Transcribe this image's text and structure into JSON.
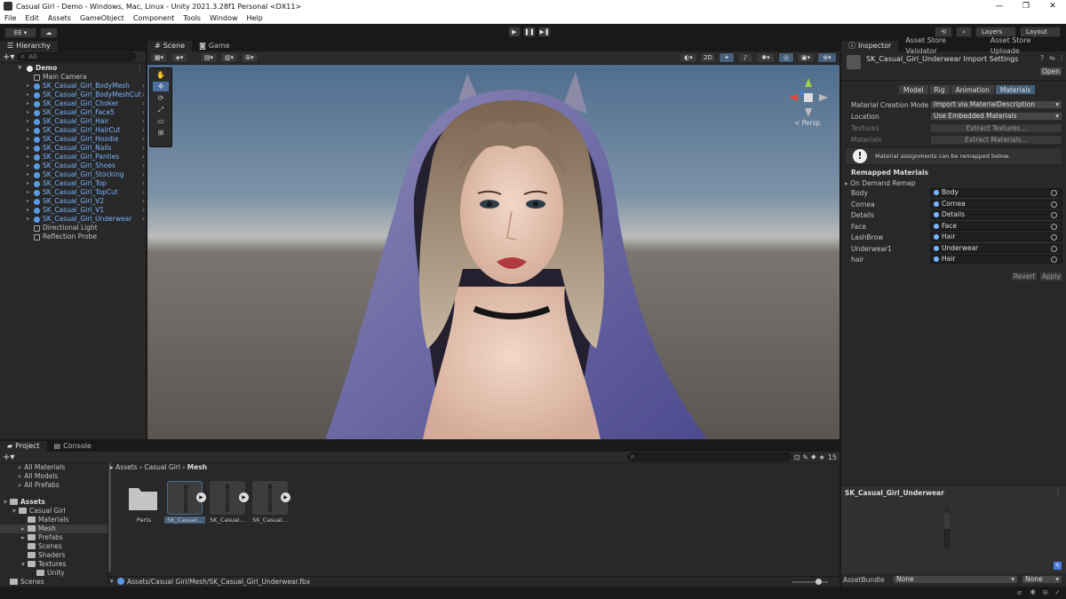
{
  "window": {
    "title": "Casual Girl - Demo - Windows, Mac, Linux - Unity 2021.3.28f1 Personal <DX11>",
    "minimize": "—",
    "maximize": "❐",
    "close": "✕"
  },
  "menu": [
    "File",
    "Edit",
    "Assets",
    "GameObject",
    "Component",
    "Tools",
    "Window",
    "Help"
  ],
  "toolbar": {
    "account": "EE ▾",
    "cloud": "☁",
    "play": "▶",
    "pause": "❚❚",
    "step": "▶❚",
    "history": "⟲",
    "search": "⌕",
    "layers": "Layers",
    "layout": "Layout"
  },
  "hierarchy": {
    "tab": "Hierarchy",
    "search_placeholder": "All",
    "root": "Demo",
    "items": [
      {
        "name": "Main Camera",
        "prefab": false
      },
      {
        "name": "SK_Casual_Girl_BodyMesh",
        "prefab": true
      },
      {
        "name": "SK_Casual_Girl_BodyMeshCut",
        "prefab": true
      },
      {
        "name": "SK_Casual_Girl_Choker",
        "prefab": true
      },
      {
        "name": "SK_Casual_Girl_Face5",
        "prefab": true
      },
      {
        "name": "SK_Casual_Girl_Hair",
        "prefab": true
      },
      {
        "name": "SK_Casual_Girl_HairCut",
        "prefab": true
      },
      {
        "name": "SK_Casual_Girl_Hoodie",
        "prefab": true
      },
      {
        "name": "SK_Casual_Girl_Nails",
        "prefab": true
      },
      {
        "name": "SK_Casual_Girl_Panties",
        "prefab": true
      },
      {
        "name": "SK_Casual_Girl_Shoes",
        "prefab": true
      },
      {
        "name": "SK_Casual_Girl_Stocking",
        "prefab": true
      },
      {
        "name": "SK_Casual_Girl_Top",
        "prefab": true
      },
      {
        "name": "SK_Casual_Girl_TopCut",
        "prefab": true
      },
      {
        "name": "SK_Casual_Girl_V2",
        "prefab": true
      },
      {
        "name": "SK_Casual_Girl_V1",
        "prefab": true
      },
      {
        "name": "SK_Casual_Girl_Underwear",
        "prefab": true
      },
      {
        "name": "Directional Light",
        "prefab": false
      },
      {
        "name": "Reflection Probe",
        "prefab": false
      }
    ]
  },
  "scene": {
    "tab_scene": "Scene",
    "tab_game": "Game",
    "mode_2d": "2D",
    "persp_label": "≺ Persp"
  },
  "inspector": {
    "tabs": [
      "Inspector",
      "Asset Store Validator",
      "Asset Store Uploade"
    ],
    "title": "SK_Casual_Girl_Underwear Import Settings",
    "open_button": "Open",
    "subtabs": [
      "Model",
      "Rig",
      "Animation",
      "Materials"
    ],
    "material_creation_mode_label": "Material Creation Mode",
    "material_creation_mode_value": "Import via MaterialDescription",
    "location_label": "Location",
    "location_value": "Use Embedded Materials",
    "textures_label": "Textures",
    "extract_textures": "Extract Textures...",
    "materials_label": "Materials",
    "extract_materials": "Extract Materials...",
    "info": "Material assignments can be remapped below.",
    "remapped_header": "Remapped Materials",
    "on_demand": "On Demand Remap",
    "remaps": [
      {
        "slot": "Body",
        "material": "Body"
      },
      {
        "slot": "Cornea",
        "material": "Cornea"
      },
      {
        "slot": "Details",
        "material": "Details"
      },
      {
        "slot": "Face",
        "material": "Face"
      },
      {
        "slot": "LashBrow",
        "material": "Hair"
      },
      {
        "slot": "Underwear1",
        "material": "Underwear"
      },
      {
        "slot": "hair",
        "material": "Hair"
      }
    ],
    "revert": "Revert",
    "apply": "Apply",
    "preview_title": "SK_Casual_Girl_Underwear",
    "assetbundle_label": "AssetBundle",
    "assetbundle_value": "None",
    "assetbundle_variant": "None"
  },
  "project": {
    "tab_project": "Project",
    "tab_console": "Console",
    "favorites": [
      "All Materials",
      "All Models",
      "All Prefabs"
    ],
    "tree": [
      {
        "label": "Assets",
        "indent": 0,
        "bold": true
      },
      {
        "label": "Casual Girl",
        "indent": 1
      },
      {
        "label": "Materials",
        "indent": 2
      },
      {
        "label": "Mesh",
        "indent": 2,
        "selected": true
      },
      {
        "label": "Prefabs",
        "indent": 2
      },
      {
        "label": "Scenes",
        "indent": 2
      },
      {
        "label": "Shaders",
        "indent": 2
      },
      {
        "label": "Textures",
        "indent": 2
      },
      {
        "label": "Unity",
        "indent": 3
      },
      {
        "label": "Scenes",
        "indent": 0
      }
    ],
    "breadcrumb": [
      "Assets",
      "Casual Girl",
      "Mesh"
    ],
    "assets": [
      "Parts",
      "SK_Casual...",
      "SK_Casual...",
      "SK_Casual..."
    ],
    "search_count": "15",
    "path": "Assets/Casual Girl/Mesh/SK_Casual_Girl_Underwear.fbx"
  }
}
